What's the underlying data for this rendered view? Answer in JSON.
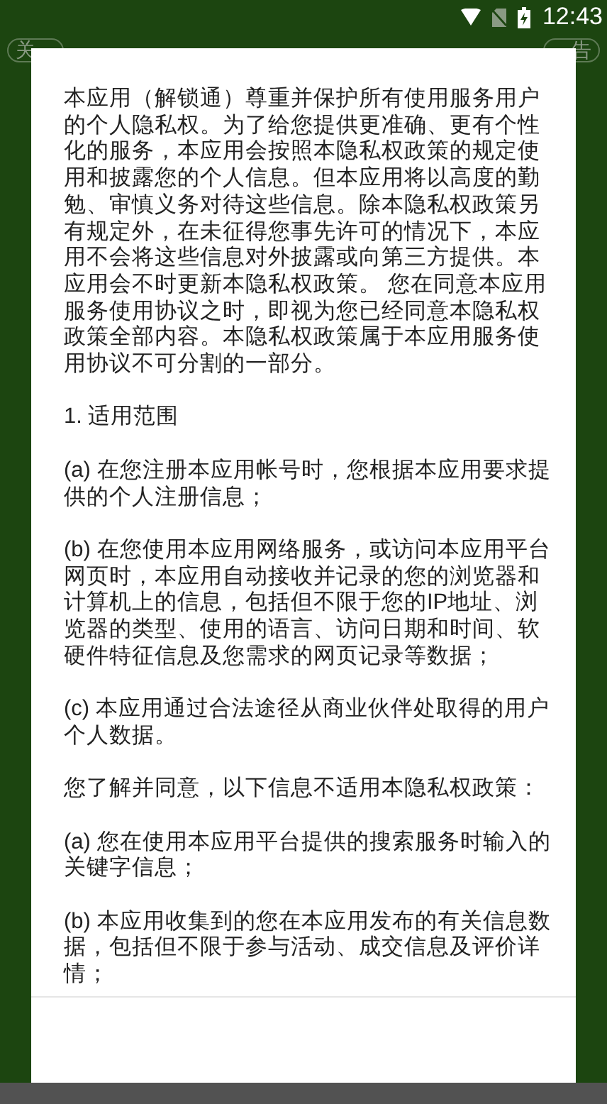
{
  "status_bar": {
    "time": "12:43"
  },
  "background_buttons": [
    {
      "label": "关"
    },
    {
      "label": "告"
    }
  ],
  "dialog": {
    "paragraphs": [
      "本应用（解锁通）尊重并保护所有使用服务用户的个人隐私权。为了给您提供更准确、更有个性化的服务，本应用会按照本隐私权政策的规定使用和披露您的个人信息。但本应用将以高度的勤勉、审慎义务对待这些信息。除本隐私权政策另有规定外，在未征得您事先许可的情况下，本应用不会将这些信息对外披露或向第三方提供。本应用会不时更新本隐私权政策。 您在同意本应用服务使用协议之时，即视为您已经同意本隐私权政策全部内容。本隐私权政策属于本应用服务使用协议不可分割的一部分。",
      "1. 适用范围",
      "(a) 在您注册本应用帐号时，您根据本应用要求提供的个人注册信息；",
      "(b) 在您使用本应用网络服务，或访问本应用平台网页时，本应用自动接收并记录的您的浏览器和计算机上的信息，包括但不限于您的IP地址、浏览器的类型、使用的语言、访问日期和时间、软硬件特征信息及您需求的网页记录等数据；",
      "(c) 本应用通过合法途径从商业伙伴处取得的用户个人数据。",
      "您了解并同意，以下信息不适用本隐私权政策：",
      "(a) 您在使用本应用平台提供的搜索服务时输入的关键字信息；",
      "(b) 本应用收集到的您在本应用发布的有关信息数据，包括但不限于参与活动、成交信息及评价详情；"
    ]
  }
}
